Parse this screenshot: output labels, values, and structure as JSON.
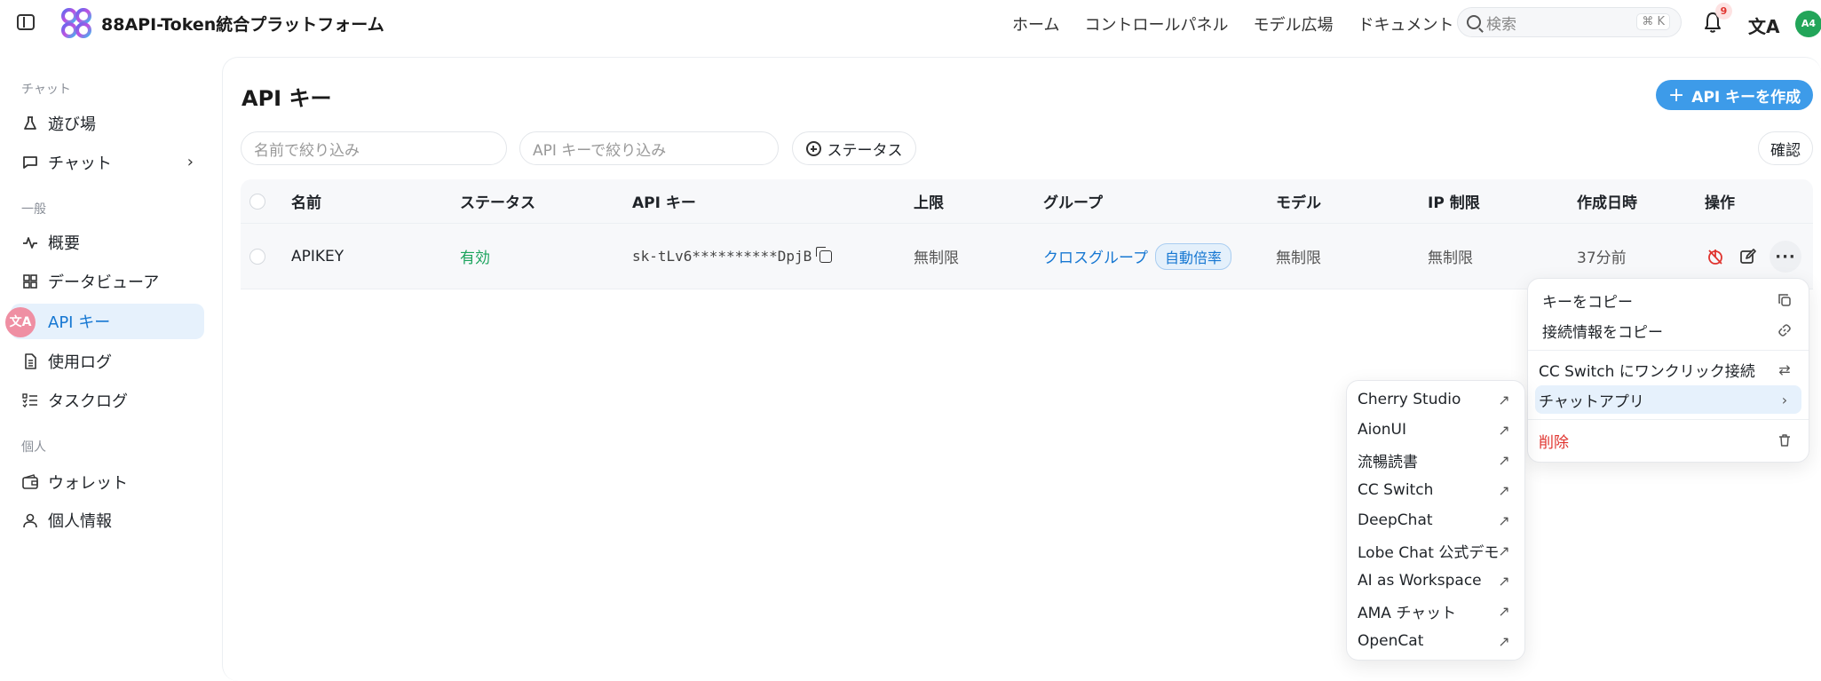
{
  "header": {
    "title": "88API-Token統合プラットフォーム",
    "nav": [
      "ホーム",
      "コントロールパネル",
      "モデル広場",
      "ドキュメント"
    ],
    "search_placeholder": "検索",
    "search_shortcut": "⌘ K",
    "notification_count": "9",
    "avatar_initials": "A4",
    "brand_color": "#3d9be9"
  },
  "sidebar": {
    "sections": [
      {
        "label": "チャット",
        "items": [
          {
            "label": "遊び場",
            "icon": "flask-icon"
          },
          {
            "label": "チャット",
            "icon": "message-icon"
          }
        ]
      },
      {
        "label": "一般",
        "items": [
          {
            "label": "概要",
            "icon": "activity-icon"
          },
          {
            "label": "データビューア",
            "icon": "grid-icon"
          },
          {
            "label": "API キー",
            "icon": "key-icon"
          },
          {
            "label": "使用ログ",
            "icon": "file-icon"
          },
          {
            "label": "タスクログ",
            "icon": "list-icon"
          }
        ]
      },
      {
        "label": "個人",
        "items": [
          {
            "label": "ウォレット",
            "icon": "wallet-icon"
          },
          {
            "label": "個人情報",
            "icon": "user-icon"
          }
        ]
      }
    ],
    "float_badge": "文A"
  },
  "main": {
    "title": "API キー",
    "create_label": "API キーを作成",
    "filter_name_placeholder": "名前で絞り込み",
    "filter_key_placeholder": "API キーで絞り込み",
    "status_filter_label": "ステータス",
    "confirm_label": "確認"
  },
  "table": {
    "headers": [
      "名前",
      "ステータス",
      "API キー",
      "上限",
      "グループ",
      "モデル",
      "IP 制限",
      "作成日時",
      "操作"
    ],
    "rows": [
      {
        "name": "APIKEY",
        "status": "有効",
        "key": "sk-tLv6**********DpjB",
        "limit": "無制限",
        "group": "クロスグループ",
        "group_tag": "自動倍率",
        "model": "無制限",
        "ip": "無制限",
        "created": "37分前"
      }
    ]
  },
  "action_menu": {
    "items": [
      "キーをコピー",
      "接続情報をコピー",
      "CC Switch にワンクリック接続",
      "チャットアプリ",
      "削除"
    ]
  },
  "chat_apps_menu": {
    "items": [
      "Cherry Studio",
      "AionUI",
      "流暢読書",
      "CC Switch",
      "DeepChat",
      "Lobe Chat 公式デモ",
      "AI as Workspace",
      "AMA チャット",
      "OpenCat"
    ]
  }
}
